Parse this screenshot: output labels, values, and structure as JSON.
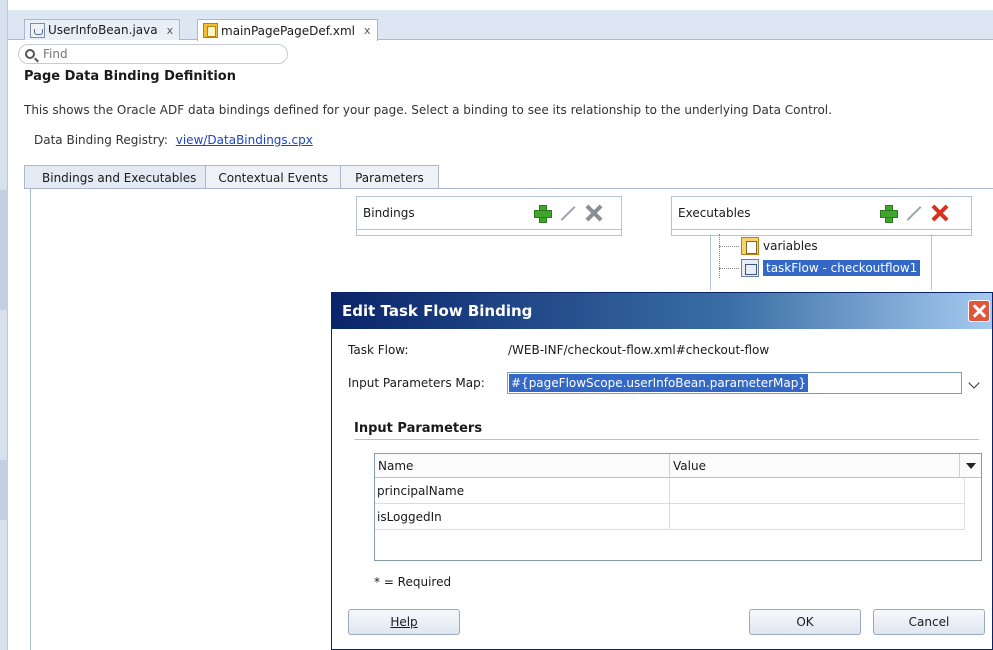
{
  "editor_tabs": [
    {
      "label": "UserInfoBean.java",
      "close": "x",
      "icon": "java-file-icon"
    },
    {
      "label": "mainPagePageDef.xml",
      "close": "x",
      "icon": "xml-file-icon"
    }
  ],
  "find": {
    "placeholder": "Find"
  },
  "page": {
    "title": "Page Data Binding Definition",
    "description": "This shows the Oracle ADF data bindings defined for your page. Select a binding to see its relationship to the underlying Data Control.",
    "registry_label": "Data Binding Registry:",
    "registry_link": "view/DataBindings.cpx"
  },
  "main_tabs": [
    "Bindings and Executables",
    "Contextual Events",
    "Parameters"
  ],
  "bindings_panel": {
    "title": "Bindings"
  },
  "executables_panel": {
    "title": "Executables",
    "items": [
      "variables",
      "taskFlow - checkoutflow1"
    ]
  },
  "dialog": {
    "title": "Edit Task Flow Binding",
    "task_flow_label": "Task Flow:",
    "task_flow_value": "/WEB-INF/checkout-flow.xml#checkout-flow",
    "input_map_label": "Input Parameters Map:",
    "input_map_value": "#{pageFlowScope.userInfoBean.parameterMap}",
    "section_title": "Input Parameters",
    "table": {
      "columns": [
        "Name",
        "Value"
      ],
      "rows": [
        {
          "name": "principalName",
          "value": ""
        },
        {
          "name": "isLoggedIn",
          "value": ""
        }
      ]
    },
    "required_note": "* = Required",
    "buttons": {
      "help": "Help",
      "ok": "OK",
      "cancel": "Cancel"
    }
  },
  "colors": {
    "selection": "#3368c6",
    "dialog_title_bar": "#0a246a",
    "add_green": "#3fa52d",
    "delete_red": "#d8321f"
  }
}
